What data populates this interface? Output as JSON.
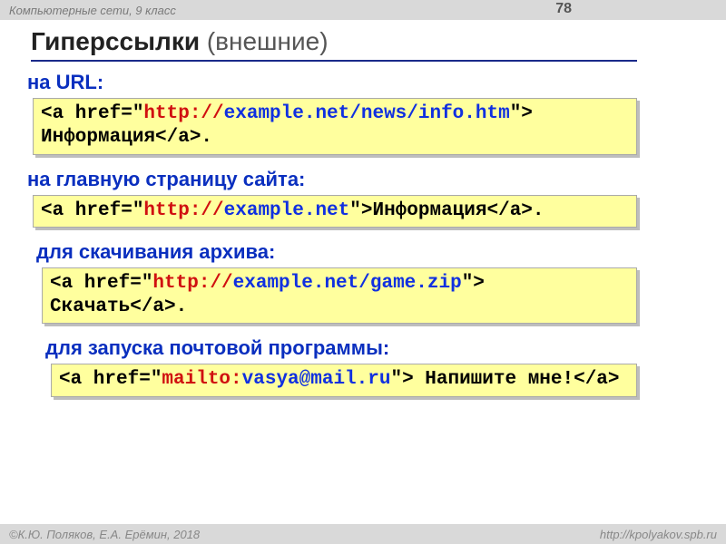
{
  "header": {
    "text": "Компьютерные сети, 9 класс",
    "page": "78"
  },
  "title": {
    "bold": "Гиперссылки",
    "rest": " (внешние)"
  },
  "sections": [
    {
      "label": "на URL:",
      "code": [
        {
          "t": "<a href=\"",
          "c": "black"
        },
        {
          "t": "http://",
          "c": "red"
        },
        {
          "t": "example.net/news/info.htm",
          "c": "blue"
        },
        {
          "t": "\"> Информация</a>.",
          "c": "black"
        }
      ]
    },
    {
      "label": "на главную страницу сайта:",
      "code": [
        {
          "t": "<a href=\"",
          "c": "black"
        },
        {
          "t": "http://",
          "c": "red"
        },
        {
          "t": "example.net",
          "c": "blue"
        },
        {
          "t": "\">Информация</a>.",
          "c": "black"
        }
      ]
    },
    {
      "label": "для скачивания архива:",
      "code": [
        {
          "t": "<a href=\"",
          "c": "black"
        },
        {
          "t": "http://",
          "c": "red"
        },
        {
          "t": "example.net/game.zip",
          "c": "blue"
        },
        {
          "t": "\"> Скачать</a>.",
          "c": "black"
        }
      ]
    },
    {
      "label": "для запуска почтовой программы:",
      "code": [
        {
          "t": "<a href=\"",
          "c": "black"
        },
        {
          "t": "mailto:",
          "c": "red"
        },
        {
          "t": "vasya@mail.ru",
          "c": "blue"
        },
        {
          "t": "\"> Напишите мне!</a>",
          "c": "black"
        }
      ]
    }
  ],
  "footer": {
    "left": "К.Ю. Поляков, Е.А. Ерёмин, 2018",
    "right": "http://kpolyakov.spb.ru"
  }
}
